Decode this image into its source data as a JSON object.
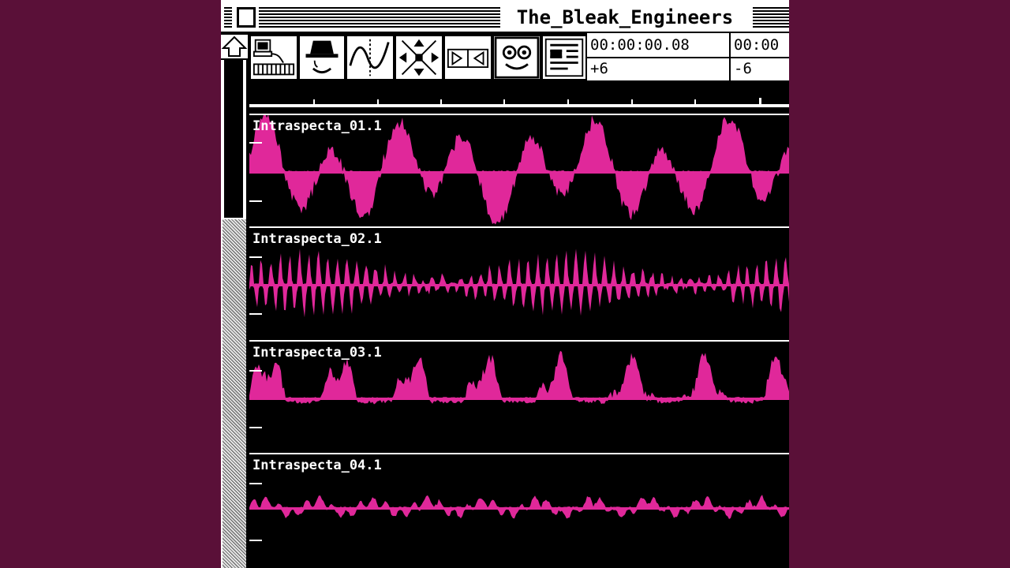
{
  "window": {
    "title": "The_Bleak_Engineers"
  },
  "counters": {
    "time_left": "00:00:00.08",
    "time_right": "00:00",
    "level_left": "+6",
    "level_right": "-6"
  },
  "tracks": [
    {
      "name": "Intraspecta_01.1"
    },
    {
      "name": "Intraspecta_02.1"
    },
    {
      "name": "Intraspecta_03.1"
    },
    {
      "name": "Intraspecta_04.1"
    }
  ],
  "colors": {
    "waveform": "#e0289a",
    "background": "#5a1038",
    "window": "#000000"
  },
  "icons": [
    "close-box-icon",
    "up-arrow-icon",
    "computer-keyboard-icon",
    "hat-face-icon",
    "waveform-icon",
    "move-arrows-icon",
    "playback-icon",
    "face-icon",
    "document-icon"
  ]
}
